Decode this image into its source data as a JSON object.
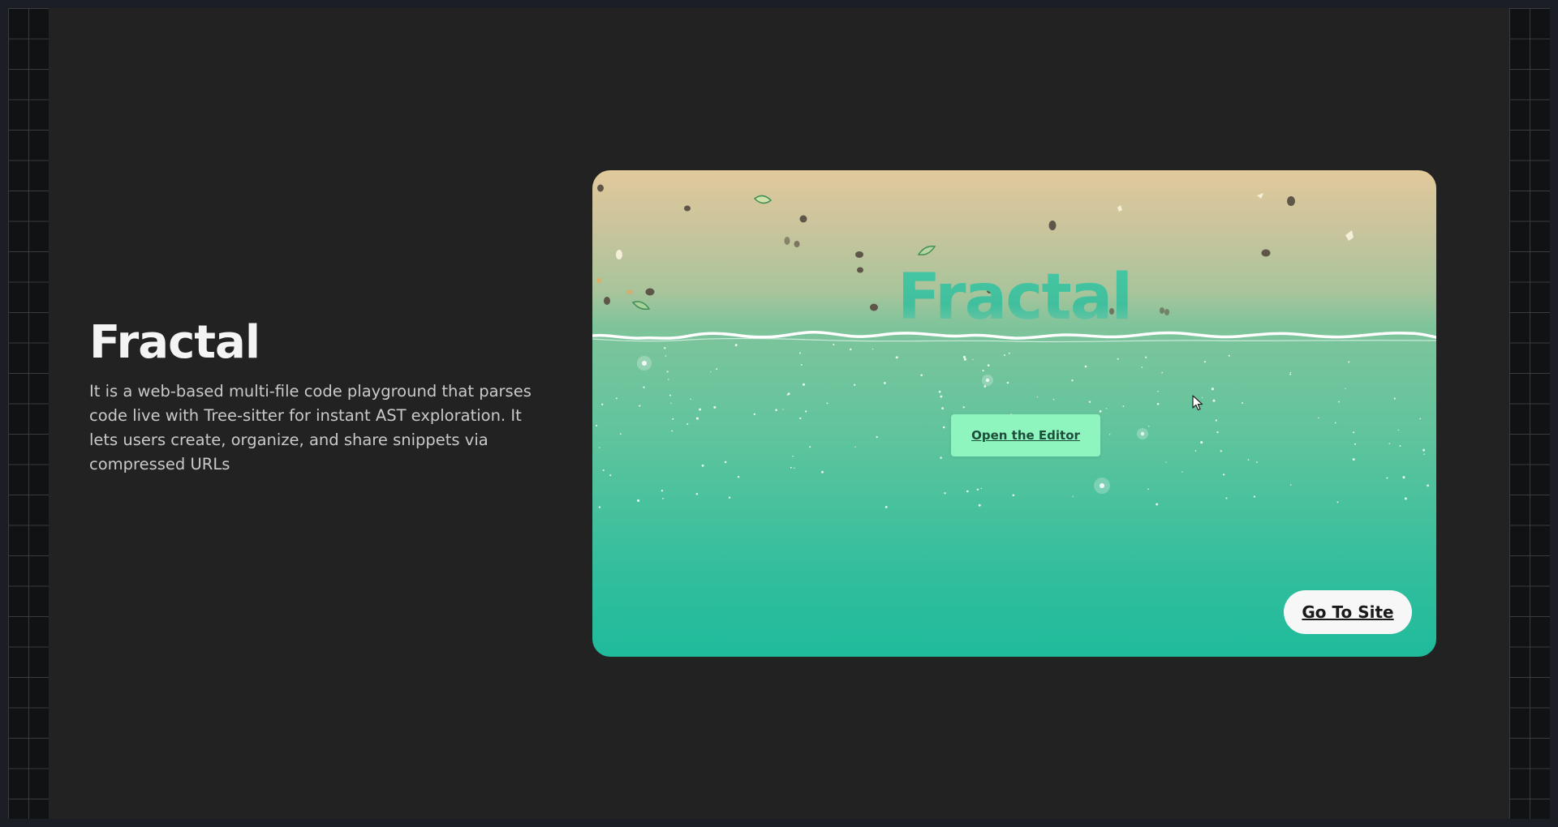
{
  "project": {
    "title": "Fractal",
    "description": "It is a web-based multi-file code playground that parses code live with Tree-sitter for instant AST exploration. It lets users create, organize, and share snippets via compressed URLs"
  },
  "preview": {
    "logo_text": "Fractal",
    "open_editor_label": "Open the Editor",
    "go_to_site_label": "Go To Site"
  },
  "icons": {
    "cursor": "mouse-pointer-icon"
  },
  "colors": {
    "page_background": "#222222",
    "sand": "#e2c99c",
    "water": "#1fbb9b",
    "editor_button": "#8ef5bf",
    "site_button": "#f7f7f7"
  }
}
